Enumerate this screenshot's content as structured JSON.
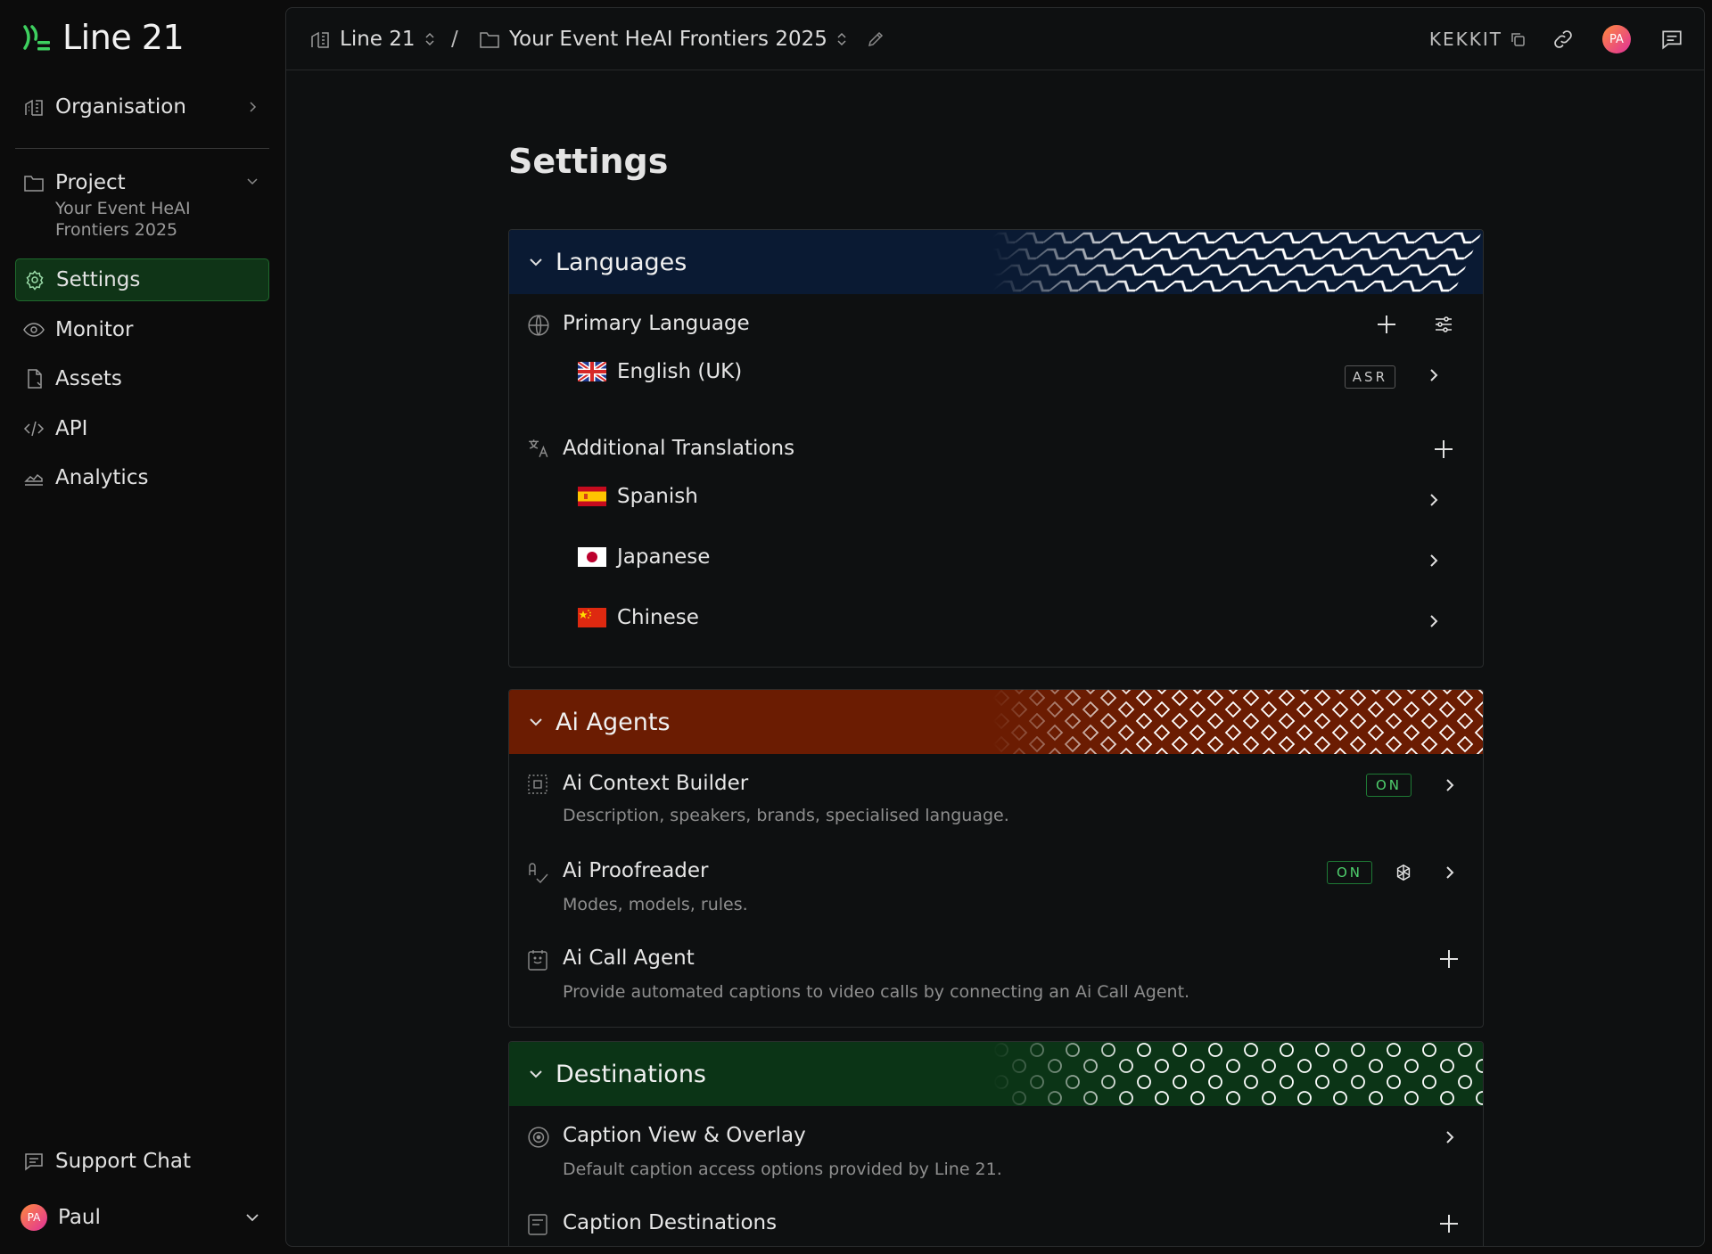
{
  "app": {
    "name": "Line 21"
  },
  "sidebar": {
    "organisation_label": "Organisation",
    "project": {
      "label": "Project",
      "name_line1": "Your Event HeAI",
      "name_line2": "Frontiers 2025"
    },
    "items": [
      {
        "label": "Settings"
      },
      {
        "label": "Monitor"
      },
      {
        "label": "Assets"
      },
      {
        "label": "API"
      },
      {
        "label": "Analytics"
      }
    ],
    "support_chat": "Support Chat",
    "user": {
      "name": "Paul",
      "initials": "PA"
    }
  },
  "topbar": {
    "org_crumb": "Line 21",
    "separator": "/",
    "project_crumb": "Your Event HeAI Frontiers 2025",
    "code": "KEKKIT",
    "avatar_initials": "PA"
  },
  "page": {
    "title": "Settings"
  },
  "languages": {
    "title": "Languages",
    "header_color": "#0a1a33",
    "primary": {
      "label": "Primary Language",
      "language": "English (UK)",
      "badge": "ASR"
    },
    "additional": {
      "label": "Additional Translations",
      "languages": [
        "Spanish",
        "Japanese",
        "Chinese"
      ]
    }
  },
  "ai_agents": {
    "title": "Ai Agents",
    "header_color": "#6b1c02",
    "items": [
      {
        "title": "Ai Context Builder",
        "desc": "Description, speakers, brands, specialised language.",
        "status": "ON"
      },
      {
        "title": "Ai Proofreader",
        "desc": "Modes, models, rules.",
        "status": "ON"
      },
      {
        "title": "Ai Call Agent",
        "desc": "Provide automated captions to video calls by connecting an Ai Call Agent."
      }
    ]
  },
  "destinations": {
    "title": "Destinations",
    "header_color": "#0b3416",
    "items": [
      {
        "title": "Caption View & Overlay",
        "desc": "Default caption access options provided by Line 21."
      },
      {
        "title": "Caption Destinations"
      }
    ]
  }
}
